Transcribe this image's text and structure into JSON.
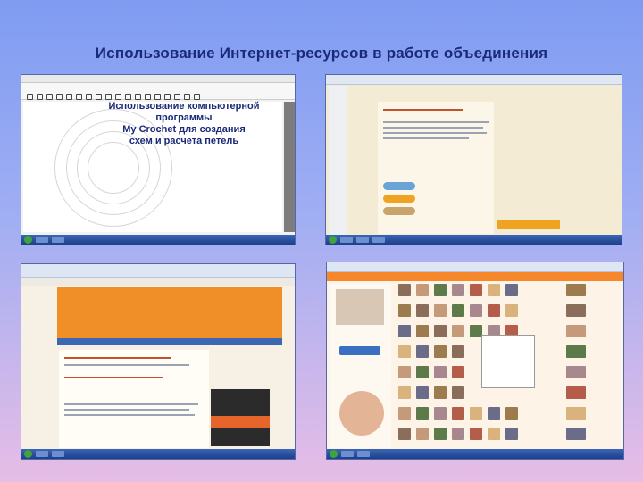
{
  "slide": {
    "title": "Использование Интернет-ресурсов в работе объединения",
    "caption_lines": [
      "Использование компьютерной",
      "программы",
      "My Crochet  для создания",
      "схем  и расчета петель"
    ]
  },
  "screens": {
    "program": {
      "name": "crochet-program-screenshot",
      "colors": {
        "canvas": "#ffffff",
        "panel": "#7c7c7c"
      }
    },
    "lessons": {
      "name": "crochet-lessons-browser-screenshot",
      "colors": {
        "page": "#f4ebd5",
        "knit": [
          "#6aa3d6",
          "#f0a221",
          "#c9a46a"
        ]
      }
    },
    "blog": {
      "name": "crochet-blog-browser-screenshot",
      "colors": {
        "banner": "#f08f28",
        "bar": "#3b67b3"
      }
    },
    "social": {
      "name": "social-network-photos-screenshot",
      "colors": {
        "topbar": "#f6872a"
      }
    }
  }
}
